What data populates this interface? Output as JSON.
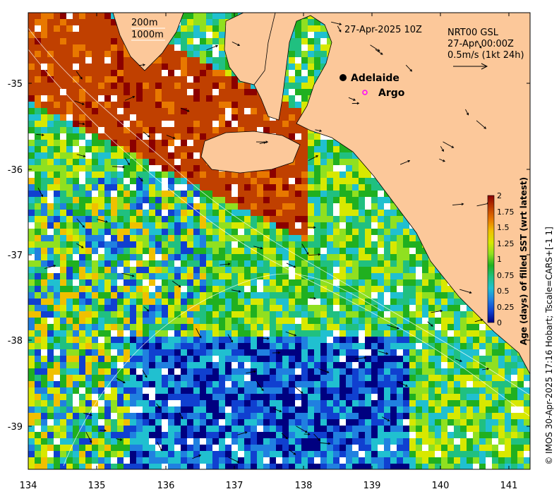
{
  "map": {
    "header_date": "27-Apr-2025 10Z",
    "contour_labels": [
      "200m",
      "1000m"
    ],
    "current_info": [
      "NRT00 GSL",
      "27-Apr 00:00Z",
      "0.5m/s (1kt 24h)"
    ],
    "places": [
      {
        "name": "Adelaide",
        "marker": "filled-black-dot"
      },
      {
        "name": "Argo",
        "marker": "magenta-ring"
      }
    ],
    "x_ticks": [
      "134",
      "135",
      "136",
      "137",
      "138",
      "139",
      "140",
      "141"
    ],
    "y_ticks": [
      "-35",
      "-36",
      "-37",
      "-38",
      "-39"
    ],
    "colorbar": {
      "title": "Age (days) of filled SST (wrt latest)",
      "ticks": [
        "2",
        "1.75",
        "1.5",
        "1.25",
        "1",
        "0.75",
        "0.5",
        "0.25",
        "0"
      ],
      "colors": [
        "#8b0000",
        "#c04000",
        "#e87800",
        "#f0c000",
        "#d8e800",
        "#90e020",
        "#20b020",
        "#20c080",
        "#20c0d0",
        "#2080e0",
        "#1040d0",
        "#000080"
      ]
    },
    "credit": "© IMOS 30-Apr-2025 17:16 Hobart; Tscale=CARS+[-1 1]",
    "colors": {
      "land": "#fcc89a",
      "no_data": "#ffffff",
      "argo_marker": "#ff00ff"
    }
  }
}
